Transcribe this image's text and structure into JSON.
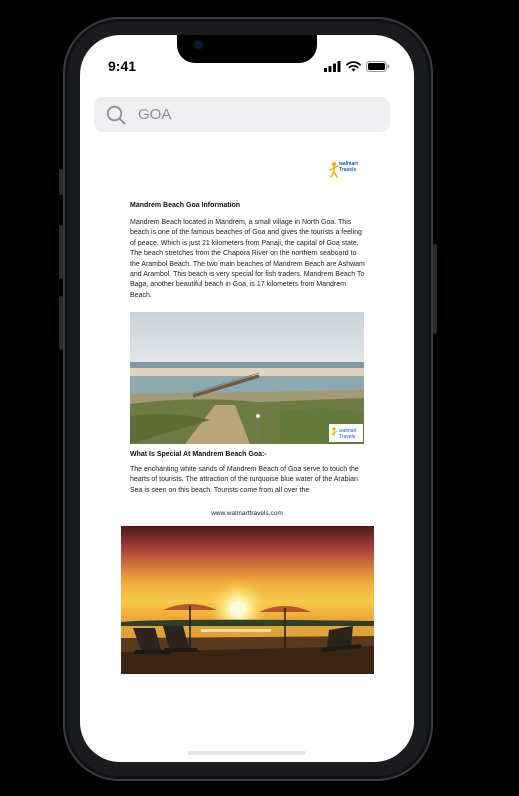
{
  "status_bar": {
    "time": "9:41"
  },
  "search": {
    "query": "GOA"
  },
  "document": {
    "logo": {
      "line1": "walmart",
      "line2": "Travels"
    },
    "heading": "Mandrem Beach Goa Information",
    "paragraph1": "Mandrem Beach located in Mandrem, a small village in North Goa. This beach is one of the famous beaches of Goa and gives the tourists a feeling of peace. Which is just 21 kilometers from Panaji, the capital of Goa state. The beach stretches from the Chapora River on the northern seaboard to the Arambol Beach. The two main beaches of Mandrem Beach are Ashwam and Arambol. This beach is very special for fish traders. Mandrem Beach To Baga, another beautiful beach in Goa, is 17 kilometers from Mandrem Beach.",
    "subheading": "What Is Special At Mandrem Beach Goa:-",
    "paragraph2": "The enchanting white sands of Mandrem Beach of Goa serve to touch the hearts of tourists. The attraction of the turquoise blue water of the Arabian Sea is seen on this beach. Tourists come from all over the",
    "footer": "www.walmarttravels.com"
  },
  "icons": {
    "search": "search-icon",
    "signal": "signal-icon",
    "wifi": "wifi-icon",
    "battery": "battery-icon"
  }
}
